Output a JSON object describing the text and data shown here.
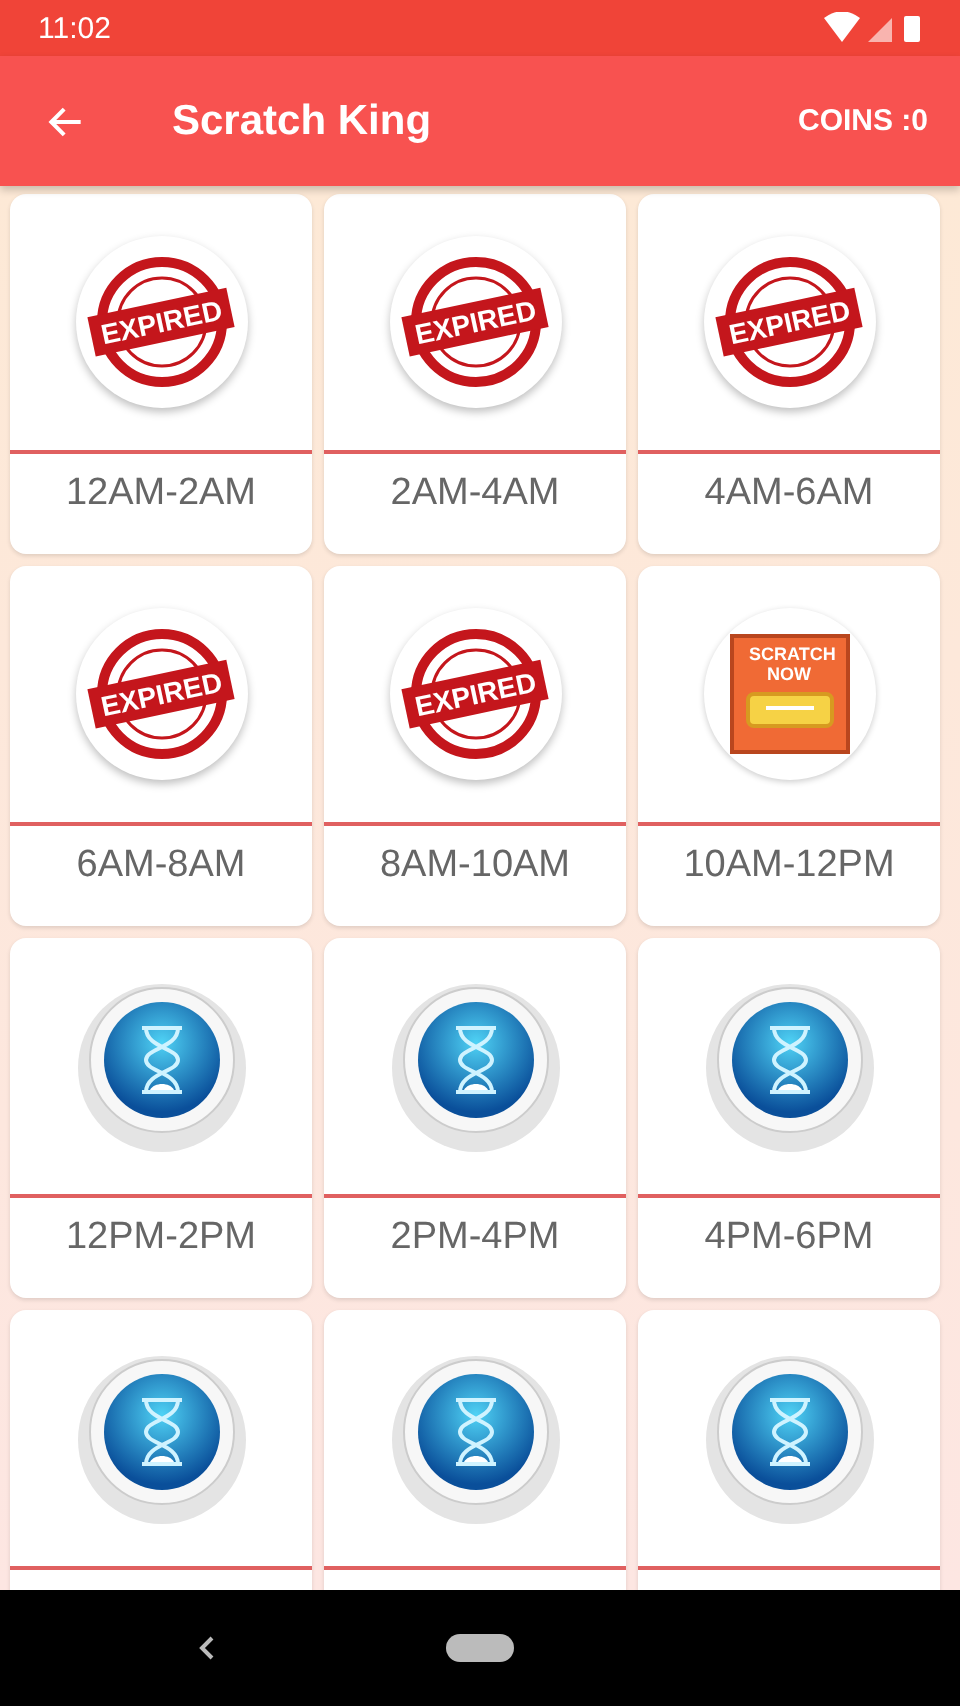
{
  "status_bar": {
    "time": "11:02"
  },
  "app_bar": {
    "title": "Scratch King",
    "coins": "COINS :0"
  },
  "slots": [
    {
      "kind": "expired",
      "stamp_text": "EXPIRED",
      "label": "12AM-2AM"
    },
    {
      "kind": "expired",
      "stamp_text": "EXPIRED",
      "label": "2AM-4AM"
    },
    {
      "kind": "expired",
      "stamp_text": "EXPIRED",
      "label": "4AM-6AM"
    },
    {
      "kind": "expired",
      "stamp_text": "EXPIRED",
      "label": "6AM-8AM"
    },
    {
      "kind": "expired",
      "stamp_text": "EXPIRED",
      "label": "8AM-10AM"
    },
    {
      "kind": "scratch",
      "stamp_text": "SCRATCH NOW",
      "label": "10AM-12PM"
    },
    {
      "kind": "waiting",
      "label": "12PM-2PM"
    },
    {
      "kind": "waiting",
      "label": "2PM-4PM"
    },
    {
      "kind": "waiting",
      "label": "4PM-6PM"
    },
    {
      "kind": "waiting"
    },
    {
      "kind": "waiting"
    },
    {
      "kind": "waiting"
    }
  ]
}
